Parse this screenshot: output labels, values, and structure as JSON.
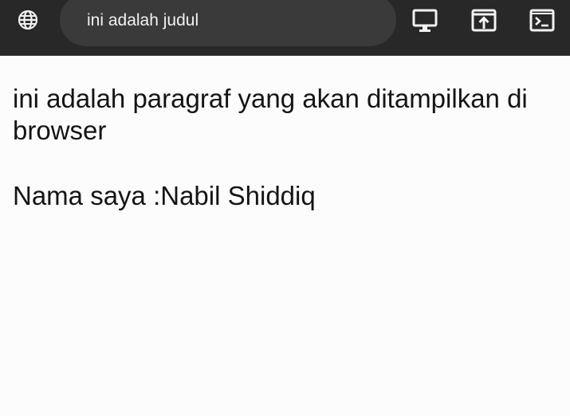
{
  "toolbar": {
    "page_title": "ini adalah judul",
    "icons": [
      "globe-icon",
      "desktop-icon",
      "open-in-window-icon",
      "terminal-icon"
    ]
  },
  "content": {
    "paragraph": "ini adalah paragraf yang akan ditampilkan di browser",
    "name_label": "Nama saya :",
    "name_value": "Nabil Shiddiq"
  },
  "colors": {
    "toolbar_bg": "#282828",
    "pill_bg": "#3a3a3a",
    "page_bg": "#fdfcfd",
    "text": "#141414"
  }
}
